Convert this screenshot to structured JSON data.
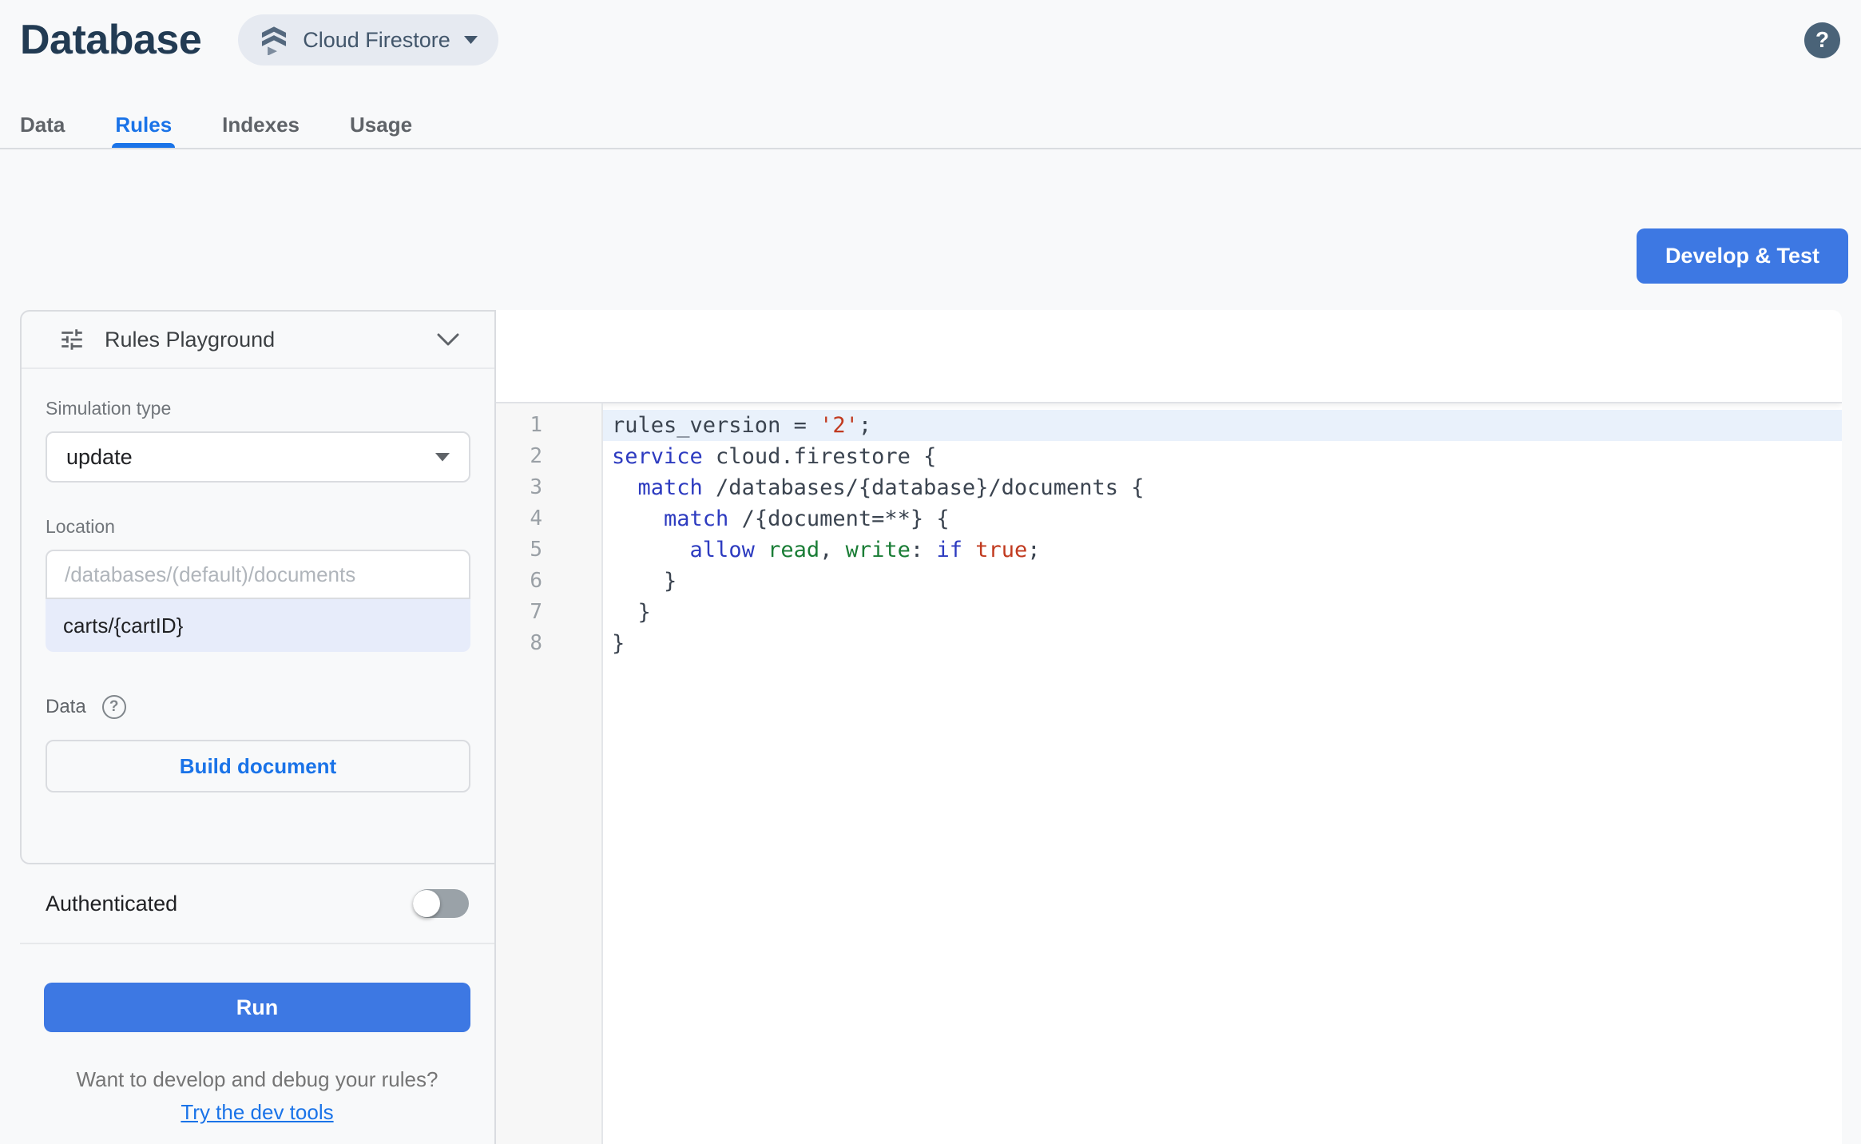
{
  "header": {
    "title": "Database",
    "product_label": "Cloud Firestore",
    "help_glyph": "?"
  },
  "tabs": [
    {
      "label": "Data",
      "active": false
    },
    {
      "label": "Rules",
      "active": true
    },
    {
      "label": "Indexes",
      "active": false
    },
    {
      "label": "Usage",
      "active": false
    }
  ],
  "toolbar": {
    "develop_test_label": "Develop & Test"
  },
  "playground": {
    "title": "Rules Playground",
    "simulation_type": {
      "label": "Simulation type",
      "value": "update"
    },
    "location": {
      "label": "Location",
      "placeholder": "/databases/(default)/documents",
      "value": "carts/{cartID}"
    },
    "data_section": {
      "label": "Data",
      "help_glyph": "?",
      "build_button_label": "Build document"
    },
    "authenticated": {
      "label": "Authenticated",
      "enabled": false
    },
    "run_label": "Run",
    "footer": {
      "question": "Want to develop and debug your rules?",
      "link_label": "Try the dev tools"
    }
  },
  "editor": {
    "lines": [
      {
        "num": "1",
        "highlight": true,
        "tokens": [
          {
            "text": "rules_version = ",
            "type": "plain"
          },
          {
            "text": "'2'",
            "type": "string"
          },
          {
            "text": ";",
            "type": "plain"
          }
        ]
      },
      {
        "num": "2",
        "highlight": false,
        "tokens": [
          {
            "text": "service",
            "type": "keyword"
          },
          {
            "text": " cloud.firestore {",
            "type": "plain"
          }
        ]
      },
      {
        "num": "3",
        "highlight": false,
        "tokens": [
          {
            "text": "  ",
            "type": "plain"
          },
          {
            "text": "match",
            "type": "keyword"
          },
          {
            "text": " /databases/{database}/documents {",
            "type": "plain"
          }
        ]
      },
      {
        "num": "4",
        "highlight": false,
        "tokens": [
          {
            "text": "    ",
            "type": "plain"
          },
          {
            "text": "match",
            "type": "keyword"
          },
          {
            "text": " /{document=**} {",
            "type": "plain"
          }
        ]
      },
      {
        "num": "5",
        "highlight": false,
        "tokens": [
          {
            "text": "      ",
            "type": "plain"
          },
          {
            "text": "allow",
            "type": "keyword"
          },
          {
            "text": " ",
            "type": "plain"
          },
          {
            "text": "read",
            "type": "method"
          },
          {
            "text": ", ",
            "type": "plain"
          },
          {
            "text": "write",
            "type": "method"
          },
          {
            "text": ": ",
            "type": "plain"
          },
          {
            "text": "if",
            "type": "keyword"
          },
          {
            "text": " ",
            "type": "plain"
          },
          {
            "text": "true",
            "type": "bool"
          },
          {
            "text": ";",
            "type": "plain"
          }
        ]
      },
      {
        "num": "6",
        "highlight": false,
        "tokens": [
          {
            "text": "    }",
            "type": "plain"
          }
        ]
      },
      {
        "num": "7",
        "highlight": false,
        "tokens": [
          {
            "text": "  }",
            "type": "plain"
          }
        ]
      },
      {
        "num": "8",
        "highlight": false,
        "tokens": [
          {
            "text": "}",
            "type": "plain"
          }
        ]
      }
    ]
  },
  "colors": {
    "accent_blue": "#3d78e3",
    "link_blue": "#1a73e8",
    "title_navy": "#223b53",
    "keyword": "#2d3bc0",
    "string": "#c13a1f",
    "bool": "#c13a1f",
    "method": "#1a7d36",
    "line_highlight": "#e9f1fb"
  }
}
